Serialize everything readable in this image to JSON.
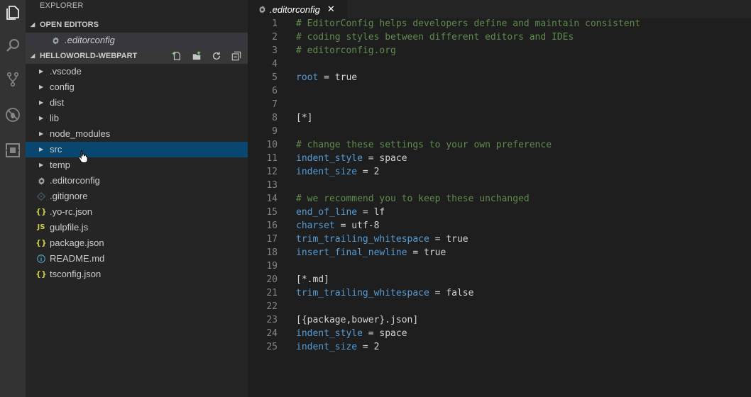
{
  "explorer": {
    "title": "EXPLORER",
    "open_editors": {
      "header": "OPEN EDITORS",
      "items": [
        {
          "name": ".editorconfig",
          "icon": "gear-icon"
        }
      ]
    },
    "folder": {
      "header": "HELLOWORLD-WEBPART",
      "actions": [
        "new-file-icon",
        "new-folder-icon",
        "refresh-icon",
        "collapse-all-icon"
      ],
      "entries": [
        {
          "name": ".vscode",
          "type": "folder",
          "selected": false
        },
        {
          "name": "config",
          "type": "folder",
          "selected": false
        },
        {
          "name": "dist",
          "type": "folder",
          "selected": false
        },
        {
          "name": "lib",
          "type": "folder",
          "selected": false
        },
        {
          "name": "node_modules",
          "type": "folder",
          "selected": false
        },
        {
          "name": "src",
          "type": "folder",
          "selected": true
        },
        {
          "name": "temp",
          "type": "folder",
          "selected": false
        },
        {
          "name": ".editorconfig",
          "type": "file",
          "icon": "gear",
          "selected": false
        },
        {
          "name": ".gitignore",
          "type": "file",
          "icon": "diamond",
          "selected": false
        },
        {
          "name": ".yo-rc.json",
          "type": "file",
          "icon": "json",
          "selected": false
        },
        {
          "name": "gulpfile.js",
          "type": "file",
          "icon": "js",
          "selected": false
        },
        {
          "name": "package.json",
          "type": "file",
          "icon": "json",
          "selected": false
        },
        {
          "name": "README.md",
          "type": "file",
          "icon": "info",
          "selected": false
        },
        {
          "name": "tsconfig.json",
          "type": "file",
          "icon": "json",
          "selected": false
        }
      ]
    }
  },
  "editor": {
    "tab": {
      "label": ".editorconfig",
      "close": "✕"
    },
    "lines": [
      {
        "n": "1",
        "tokens": [
          {
            "t": "# EditorConfig helps developers define and maintain consistent",
            "c": "comment"
          }
        ]
      },
      {
        "n": "2",
        "tokens": [
          {
            "t": "# coding styles between different editors and IDEs",
            "c": "comment"
          }
        ]
      },
      {
        "n": "3",
        "tokens": [
          {
            "t": "# editorconfig.org",
            "c": "comment"
          }
        ]
      },
      {
        "n": "4",
        "tokens": []
      },
      {
        "n": "5",
        "tokens": [
          {
            "t": "root",
            "c": "key"
          },
          {
            "t": " = ",
            "c": "op"
          },
          {
            "t": "true",
            "c": "val"
          }
        ]
      },
      {
        "n": "6",
        "tokens": []
      },
      {
        "n": "7",
        "tokens": []
      },
      {
        "n": "8",
        "tokens": [
          {
            "t": "[*]",
            "c": "sec"
          }
        ]
      },
      {
        "n": "9",
        "tokens": []
      },
      {
        "n": "10",
        "tokens": [
          {
            "t": "# change these settings to your own preference",
            "c": "comment"
          }
        ]
      },
      {
        "n": "11",
        "tokens": [
          {
            "t": "indent_style",
            "c": "key"
          },
          {
            "t": " = ",
            "c": "op"
          },
          {
            "t": "space",
            "c": "val"
          }
        ]
      },
      {
        "n": "12",
        "tokens": [
          {
            "t": "indent_size",
            "c": "key"
          },
          {
            "t": " = ",
            "c": "op"
          },
          {
            "t": "2",
            "c": "val"
          }
        ]
      },
      {
        "n": "13",
        "tokens": []
      },
      {
        "n": "14",
        "tokens": [
          {
            "t": "# we recommend you to keep these unchanged",
            "c": "comment"
          }
        ]
      },
      {
        "n": "15",
        "tokens": [
          {
            "t": "end_of_line",
            "c": "key"
          },
          {
            "t": " = ",
            "c": "op"
          },
          {
            "t": "lf",
            "c": "val"
          }
        ]
      },
      {
        "n": "16",
        "tokens": [
          {
            "t": "charset",
            "c": "key"
          },
          {
            "t": " = ",
            "c": "op"
          },
          {
            "t": "utf-8",
            "c": "val"
          }
        ]
      },
      {
        "n": "17",
        "tokens": [
          {
            "t": "trim_trailing_whitespace",
            "c": "key"
          },
          {
            "t": " = ",
            "c": "op"
          },
          {
            "t": "true",
            "c": "val"
          }
        ]
      },
      {
        "n": "18",
        "tokens": [
          {
            "t": "insert_final_newline",
            "c": "key"
          },
          {
            "t": " = ",
            "c": "op"
          },
          {
            "t": "true",
            "c": "val"
          }
        ]
      },
      {
        "n": "19",
        "tokens": []
      },
      {
        "n": "20",
        "tokens": [
          {
            "t": "[*.md]",
            "c": "sec"
          }
        ]
      },
      {
        "n": "21",
        "tokens": [
          {
            "t": "trim_trailing_whitespace",
            "c": "key"
          },
          {
            "t": " = ",
            "c": "op"
          },
          {
            "t": "false",
            "c": "val"
          }
        ]
      },
      {
        "n": "22",
        "tokens": []
      },
      {
        "n": "23",
        "tokens": [
          {
            "t": "[{package,bower}.json]",
            "c": "sec"
          }
        ]
      },
      {
        "n": "24",
        "tokens": [
          {
            "t": "indent_style",
            "c": "key"
          },
          {
            "t": " = ",
            "c": "op"
          },
          {
            "t": "space",
            "c": "val"
          }
        ]
      },
      {
        "n": "25",
        "tokens": [
          {
            "t": "indent_size",
            "c": "key"
          },
          {
            "t": " = ",
            "c": "op"
          },
          {
            "t": "2",
            "c": "val"
          }
        ]
      }
    ]
  },
  "colors": {
    "activity_bar": "#333333",
    "sidebar": "#252526",
    "selection": "#094771",
    "editor_bg": "#1e1e1e",
    "comment": "#608b4e",
    "keyword": "#569cd6"
  }
}
